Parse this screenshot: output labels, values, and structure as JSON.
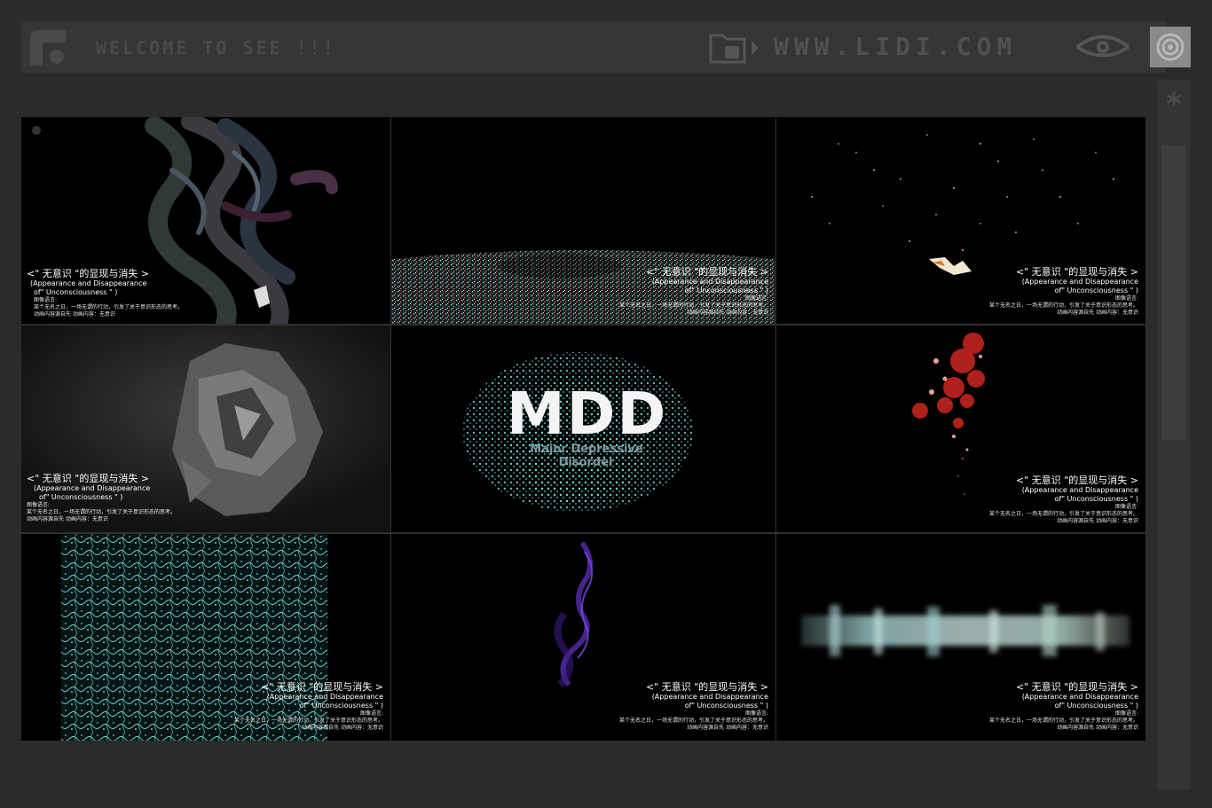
{
  "header": {
    "welcome": "WELCOME TO SEE !!!",
    "url": "WWW.LIDI.COM"
  },
  "icons": {
    "logo": "logo-icon",
    "folder": "folder-arrow-icon",
    "eye": "eye-icon",
    "target": "target-icon",
    "asterisk": "asterisk-icon"
  },
  "sidebar": {
    "asterisk": "*"
  },
  "caption": {
    "title": "<\" 无意识 \"的显现与消失 >",
    "en1": "(Appearance and Disappearance",
    "en2": "of\" Unconsciousness \" )",
    "lang": "图像语言:",
    "desc": "某个无名之日，一场无谓的行动，引发了关于意识形态的思考。",
    "source": "动画内容源自先   动画内容：无意识"
  },
  "mdd": {
    "title": "MDD",
    "subtitle": "Major Depressive Disorder"
  },
  "colors": {
    "bg": "#2b2b2b",
    "bar": "#353535",
    "teal": "#7fd6d6",
    "red": "#b0201a",
    "purple": "#5a2bb0"
  }
}
